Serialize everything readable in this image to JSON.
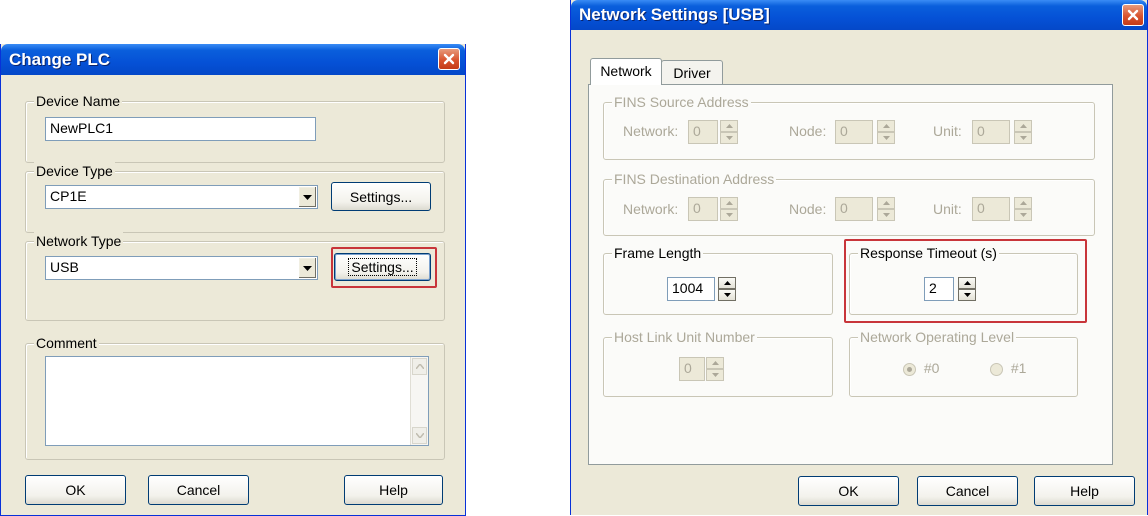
{
  "change_plc": {
    "title": "Change PLC",
    "device_name": {
      "label": "Device Name",
      "value": "NewPLC1"
    },
    "device_type": {
      "label": "Device Type",
      "value": "CP1E",
      "settings": "Settings..."
    },
    "network_type": {
      "label": "Network Type",
      "value": "USB",
      "settings": "Settings..."
    },
    "comment": {
      "label": "Comment",
      "value": ""
    },
    "buttons": {
      "ok": "OK",
      "cancel": "Cancel",
      "help": "Help"
    }
  },
  "network_settings": {
    "title": "Network Settings [USB]",
    "tabs": [
      "Network",
      "Driver"
    ],
    "fins_source": {
      "label": "FINS Source Address",
      "network_label": "Network:",
      "network_value": "0",
      "node_label": "Node:",
      "node_value": "0",
      "unit_label": "Unit:",
      "unit_value": "0"
    },
    "fins_dest": {
      "label": "FINS Destination Address",
      "network_label": "Network:",
      "network_value": "0",
      "node_label": "Node:",
      "node_value": "0",
      "unit_label": "Unit:",
      "unit_value": "0"
    },
    "frame_length": {
      "label": "Frame Length",
      "value": "1004"
    },
    "response_timeout": {
      "label": "Response Timeout (s)",
      "value": "2"
    },
    "host_link": {
      "label": "Host Link Unit Number",
      "value": "0"
    },
    "net_level": {
      "label": "Network Operating Level",
      "opt0": "#0",
      "opt1": "#1"
    },
    "buttons": {
      "ok": "OK",
      "cancel": "Cancel",
      "help": "Help"
    }
  },
  "colors": {
    "highlight": "#c8353a",
    "titlebar": "#0551d6",
    "dialog_bg": "#ece9d8"
  }
}
